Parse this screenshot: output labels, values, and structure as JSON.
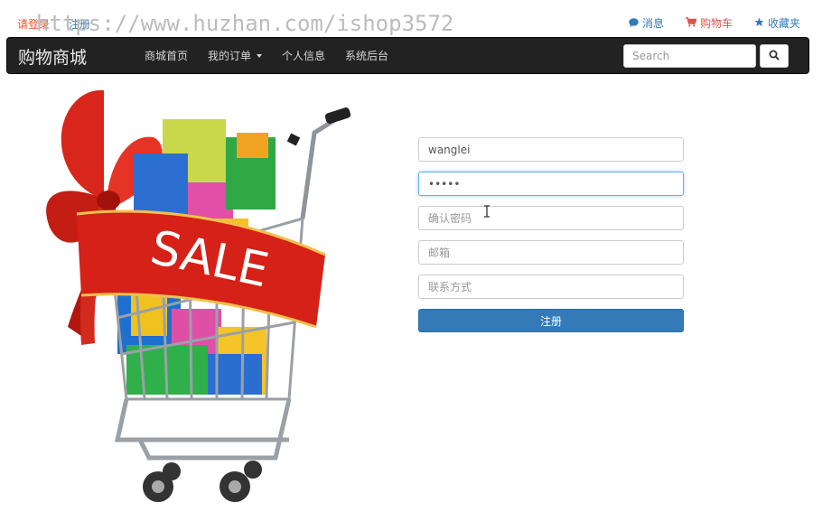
{
  "topbar": {
    "login_label": "请登录",
    "register_label": "注册",
    "watermark": "https://www.huzhan.com/ishop3572",
    "links": [
      {
        "icon": "message-icon",
        "label": "消息"
      },
      {
        "icon": "cart-icon",
        "label": "购物车"
      },
      {
        "icon": "star-icon",
        "label": "收藏夹"
      }
    ]
  },
  "navbar": {
    "brand": "购物商城",
    "items": [
      {
        "label": "商城首页"
      },
      {
        "label": "我的订单"
      },
      {
        "label": "个人信息"
      },
      {
        "label": "系统后台"
      }
    ],
    "search_placeholder": "Search",
    "search_icon": "search-icon"
  },
  "hero": {
    "sale_text": "SALE"
  },
  "form": {
    "username_value": "wanglei",
    "password_value": "•••••",
    "confirm_placeholder": "确认密码",
    "email_placeholder": "邮箱",
    "phone_placeholder": "联系方式",
    "submit_label": "注册"
  },
  "colors": {
    "navbar_bg": "#222222",
    "primary": "#337ab7",
    "link_red": "#d9534f",
    "login_orange": "#e8552b"
  }
}
